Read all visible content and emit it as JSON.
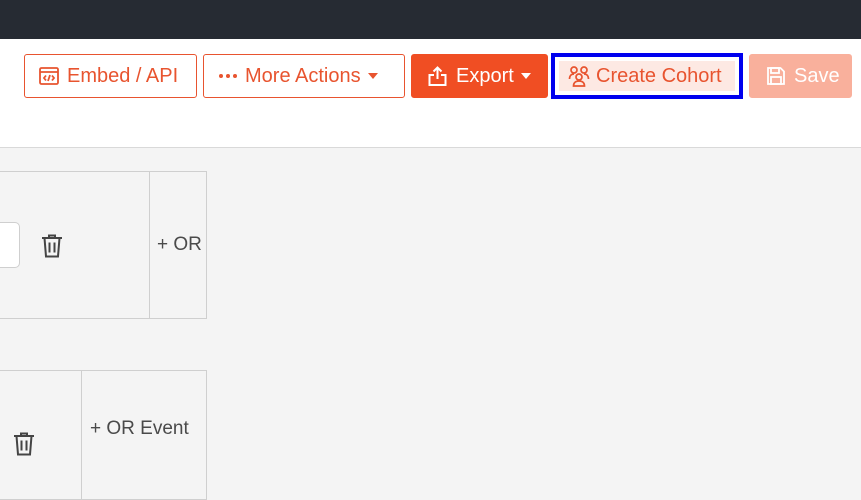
{
  "toolbar": {
    "embed_label": "Embed / API",
    "more_actions_label": "More Actions",
    "export_label": "Export",
    "create_cohort_label": "Create Cohort",
    "save_label": "Save"
  },
  "panels": [
    {
      "or_label": "+ OR"
    },
    {
      "or_label": "+ OR Event"
    }
  ],
  "icons": {
    "embed": "code-window-icon",
    "more": "ellipsis-icon",
    "export": "share-upload-icon",
    "cohort": "users-group-icon",
    "save": "floppy-disk-icon",
    "delete": "trash-icon"
  },
  "colors": {
    "topbar": "#262b33",
    "accent": "#f04e23",
    "outline": "#e8542f",
    "save_disabled": "#f9b09c",
    "highlight": "#0000ee"
  }
}
